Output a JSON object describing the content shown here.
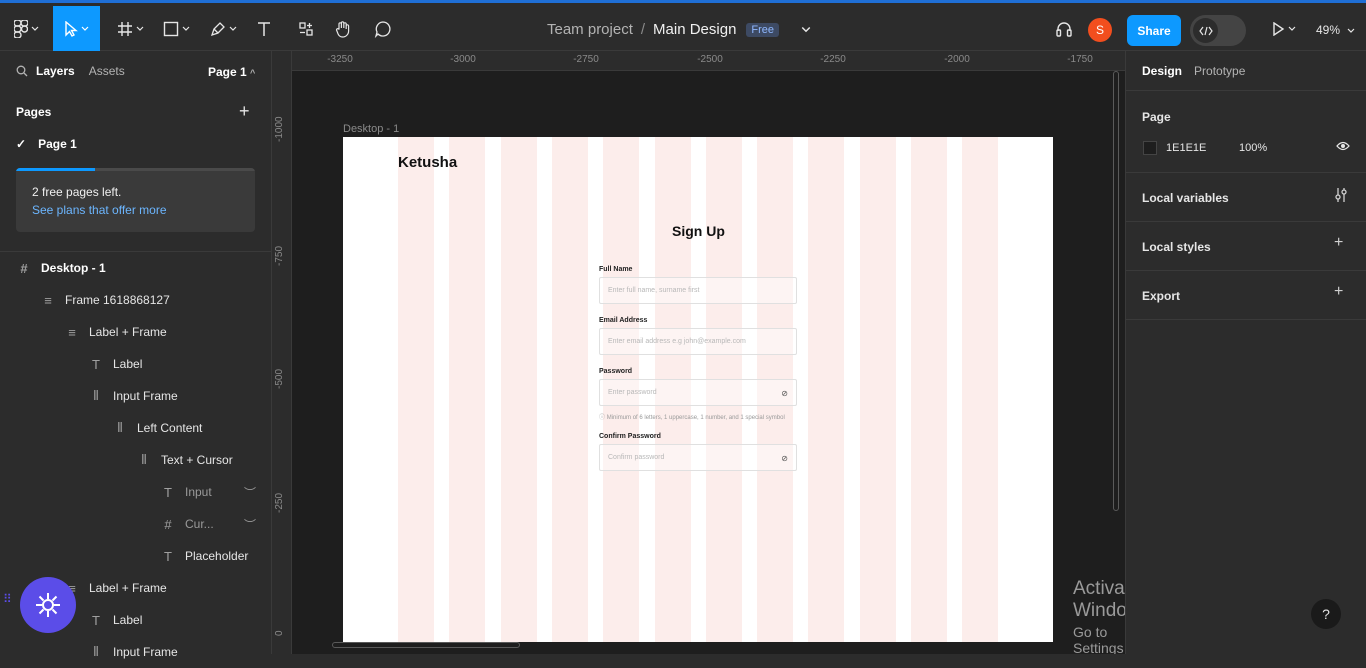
{
  "toolbar": {
    "tools": [
      "main-menu",
      "move",
      "frame",
      "shape",
      "pen",
      "text",
      "resources",
      "hand",
      "comment"
    ]
  },
  "header": {
    "team": "Team project",
    "separator": "/",
    "file": "Main Design",
    "plan_badge": "Free",
    "avatar_initial": "S",
    "share_label": "Share",
    "zoom": "49%"
  },
  "left_panel": {
    "tab_layers": "Layers",
    "tab_assets": "Assets",
    "page_selector": "Page 1",
    "pages_heading": "Pages",
    "current_page": "Page 1",
    "notice_line1": "2 free pages left.",
    "notice_line2": "See plans that offer more",
    "notice_progress": 0.33,
    "layers": [
      {
        "name": "Desktop - 1",
        "icon": "#",
        "indent": 0
      },
      {
        "name": "Frame 1618868127",
        "icon": "≡",
        "indent": 1
      },
      {
        "name": "Label + Frame",
        "icon": "≡",
        "indent": 2
      },
      {
        "name": "Label",
        "icon": "T",
        "indent": 3
      },
      {
        "name": "Input Frame",
        "icon": "|||",
        "indent": 3
      },
      {
        "name": "Left Content",
        "icon": "|||",
        "indent": 4
      },
      {
        "name": "Text + Cursor",
        "icon": "|||",
        "indent": 5
      },
      {
        "name": "Input",
        "icon": "T",
        "indent": 6
      },
      {
        "name": "Cur...",
        "icon": "#",
        "indent": 6
      },
      {
        "name": "Placeholder",
        "icon": "T",
        "indent": 6
      },
      {
        "name": "Label + Frame",
        "icon": "≡",
        "indent": 2
      },
      {
        "name": "Label",
        "icon": "T",
        "indent": 3
      },
      {
        "name": "Input Frame",
        "icon": "|||",
        "indent": 3
      }
    ]
  },
  "canvas": {
    "ruler_top": [
      "-3250",
      "-3000",
      "-2750",
      "-2500",
      "-2250",
      "-2000",
      "-1750"
    ],
    "ruler_left": [
      "-1000",
      "-750",
      "-500",
      "-250",
      "0"
    ],
    "frame_name": "Desktop - 1",
    "design": {
      "logo": "Ketusha",
      "title": "Sign Up",
      "fields": [
        {
          "label": "Full Name",
          "placeholder": "Enter full name, surname first",
          "icon": ""
        },
        {
          "label": "Email Address",
          "placeholder": "Enter email address e.g john@example.com",
          "icon": ""
        },
        {
          "label": "Password",
          "placeholder": "Enter password",
          "icon": "eye-off"
        },
        {
          "label": "Confirm Password",
          "placeholder": "Confirm password",
          "icon": "eye-off"
        }
      ],
      "password_hint": "Minimum of 6 letters, 1 uppercase, 1 number, and 1 special symbol"
    },
    "watermark_title": "Activate Windows",
    "watermark_sub": "Go to Settings to activate Windows."
  },
  "right_panel": {
    "tab_design": "Design",
    "tab_prototype": "Prototype",
    "page_heading": "Page",
    "page_color": "1E1E1E",
    "page_opacity": "100%",
    "local_variables": "Local variables",
    "local_styles": "Local styles",
    "export": "Export"
  },
  "help_label": "?"
}
